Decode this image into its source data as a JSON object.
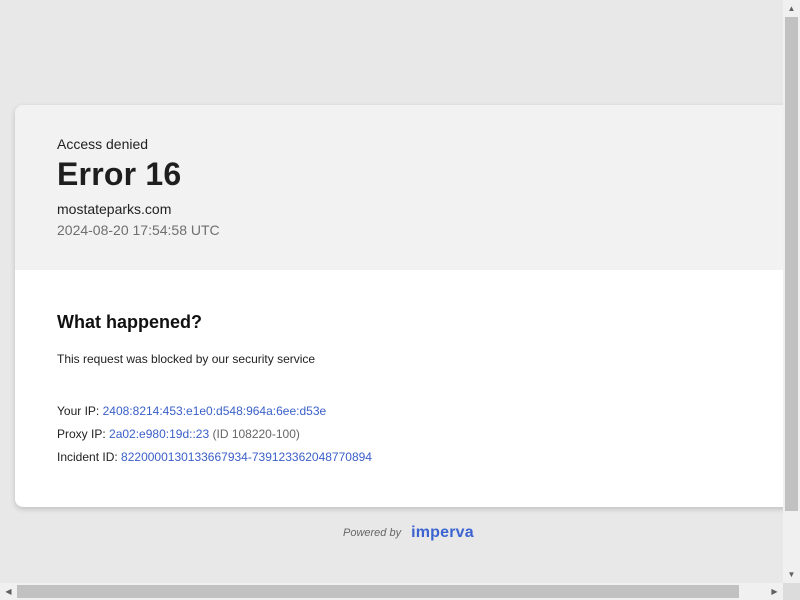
{
  "header": {
    "status": "Access denied",
    "title": "Error 16",
    "domain": "mostateparks.com",
    "timestamp": "2024-08-20 17:54:58 UTC"
  },
  "details": {
    "heading": "What happened?",
    "message": "This request was blocked by our security service",
    "your_ip_label": "Your IP:",
    "your_ip": "2408:8214:453:e1e0:d548:964a:6ee:d53e",
    "proxy_ip_label": "Proxy IP:",
    "proxy_ip": "2a02:e980:19d::23",
    "proxy_id": "(ID 108220-100)",
    "incident_label": "Incident ID:",
    "incident_id": "822000013013366793​4-739123362048770894"
  },
  "footer": {
    "powered_by": "Powered by",
    "brand": "imperva"
  },
  "colors": {
    "page_bg": "#e8e8e8",
    "header_bg": "#f2f2f2",
    "link": "#3a5fc8",
    "brand": "#3b64d1"
  },
  "icons": {
    "scroll_up": "triangle-up-icon",
    "scroll_down": "triangle-down-icon",
    "scroll_left": "triangle-left-icon",
    "scroll_right": "triangle-right-icon"
  }
}
